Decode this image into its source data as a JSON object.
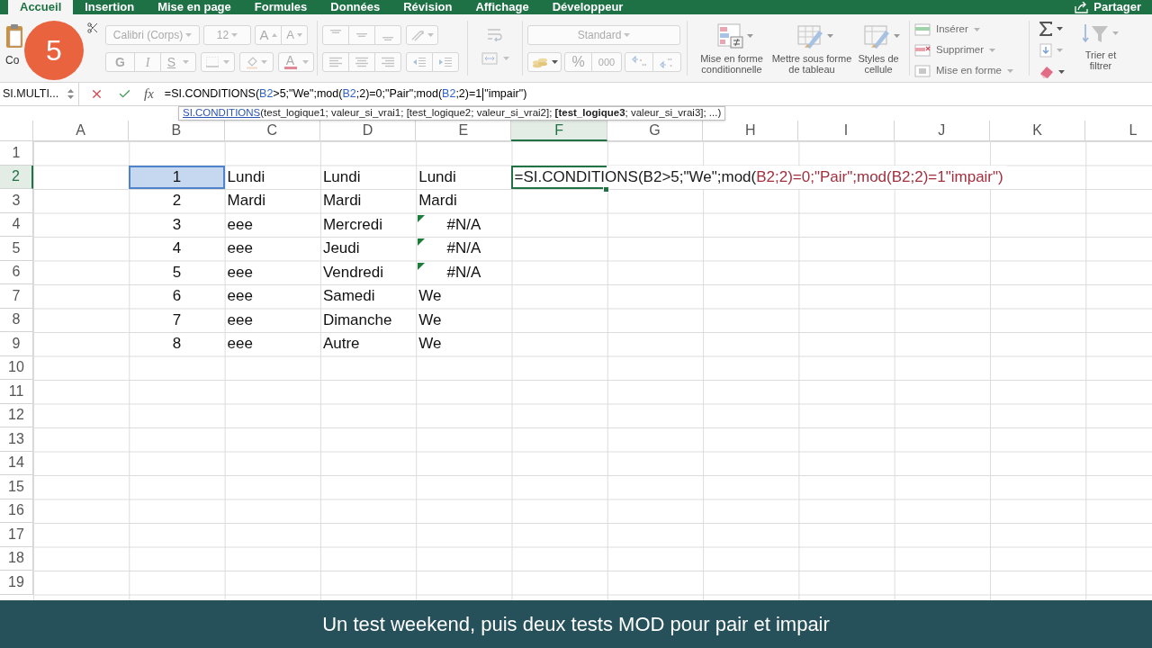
{
  "ribbon_tabs": [
    {
      "label": "Accueil",
      "selected": true
    },
    {
      "label": "Insertion",
      "selected": false
    },
    {
      "label": "Mise en page",
      "selected": false
    },
    {
      "label": "Formules",
      "selected": false
    },
    {
      "label": "Données",
      "selected": false
    },
    {
      "label": "Révision",
      "selected": false
    },
    {
      "label": "Affichage",
      "selected": false
    },
    {
      "label": "Développeur",
      "selected": false
    }
  ],
  "share_button": {
    "label": "Partager"
  },
  "ribbon": {
    "clipboard": {
      "paste_label": "Co"
    },
    "font": {
      "disabled": true,
      "font_name": "Calibri (Corps)",
      "font_size": "12",
      "grow_label": "A",
      "shrink_label": "A",
      "bold_label": "G",
      "italic_label": "I",
      "underline_label": "S",
      "font_color_label": "A"
    },
    "alignment": {
      "disabled": true
    },
    "number": {
      "disabled": true,
      "format": "Standard",
      "percent_label": "%",
      "thousands_label": "000"
    },
    "styles": [
      {
        "kind": "conditional",
        "label": "Mise en forme conditionnelle"
      },
      {
        "kind": "table",
        "label": "Mettre sous forme de tableau"
      },
      {
        "kind": "cell_styles",
        "label": "Styles de cellule"
      }
    ],
    "cells": [
      {
        "kind": "insert",
        "label": "Insérer"
      },
      {
        "kind": "delete",
        "label": "Supprimer"
      },
      {
        "kind": "format",
        "label": "Mise en forme"
      }
    ],
    "editing": {
      "sort_label": "Trier et filtrer"
    }
  },
  "formula_bar": {
    "name_box": "SI.MULTI...",
    "fx_label": "fx",
    "segments": [
      {
        "kind": "text",
        "text": "=SI.CONDITIONS(",
        "color": "#000000"
      },
      {
        "kind": "text",
        "text": "B2",
        "color": "#2f62c8"
      },
      {
        "kind": "text",
        "text": ">5;\"We\";mod(",
        "color": "#000000"
      },
      {
        "kind": "text",
        "text": "B2",
        "color": "#2f62c8"
      },
      {
        "kind": "text",
        "text": ";2)=0;\"Pair\";mod(",
        "color": "#000000"
      },
      {
        "kind": "text",
        "text": "B2",
        "color": "#2f62c8"
      },
      {
        "kind": "text",
        "text": ";2)=1",
        "color": "#000000"
      },
      {
        "kind": "cursor"
      },
      {
        "kind": "text",
        "text": "\"impair\")",
        "color": "#000000"
      }
    ]
  },
  "tooltip": {
    "function_link": "SI.CONDITIONS",
    "arguments": "(test_logique1; valeur_si_vrai1; [test_logique2; valeur_si_vrai2]; **[test_logique3**; valeur_si_vrai3]; ...)"
  },
  "columns": [
    {
      "label": "A",
      "selected": false
    },
    {
      "label": "B",
      "selected": false
    },
    {
      "label": "C",
      "selected": false
    },
    {
      "label": "D",
      "selected": false
    },
    {
      "label": "E",
      "selected": false
    },
    {
      "label": "F",
      "selected": true
    },
    {
      "label": "G",
      "selected": false
    },
    {
      "label": "H",
      "selected": false
    },
    {
      "label": "I",
      "selected": false
    },
    {
      "label": "J",
      "selected": false
    },
    {
      "label": "K",
      "selected": false
    },
    {
      "label": "L",
      "selected": false
    }
  ],
  "rows": [
    {
      "label": "1",
      "selected": false
    },
    {
      "label": "2",
      "selected": true,
      "cells": {
        "b": {
          "kind": "number",
          "value": "1",
          "referenced": true
        },
        "c": {
          "kind": "text",
          "value": "Lundi"
        },
        "d": {
          "kind": "text",
          "value": "Lundi"
        },
        "e": {
          "kind": "text",
          "value": "Lundi"
        },
        "f": {
          "kind": "editing",
          "segments": [
            {
              "text": "=SI.CONDITIONS(B2>5;\"We\";mod(",
              "color": "#1a1a1a"
            },
            {
              "text": "B2;2)=0;\"Pair\";mod(B2;2)=1\"impair\")",
              "color": "#a3303f"
            }
          ]
        }
      }
    },
    {
      "label": "3",
      "selected": false,
      "cells": {
        "b": {
          "kind": "number",
          "value": "2"
        },
        "c": {
          "kind": "text",
          "value": "Mardi"
        },
        "d": {
          "kind": "text",
          "value": "Mardi"
        },
        "e": {
          "kind": "text",
          "value": "Mardi"
        }
      }
    },
    {
      "label": "4",
      "selected": false,
      "cells": {
        "b": {
          "kind": "number",
          "value": "3"
        },
        "c": {
          "kind": "text",
          "value": "eee"
        },
        "d": {
          "kind": "text",
          "value": "Mercredi"
        },
        "e": {
          "kind": "error",
          "value": "#N/A"
        }
      }
    },
    {
      "label": "5",
      "selected": false,
      "cells": {
        "b": {
          "kind": "number",
          "value": "4"
        },
        "c": {
          "kind": "text",
          "value": "eee"
        },
        "d": {
          "kind": "text",
          "value": "Jeudi"
        },
        "e": {
          "kind": "error",
          "value": "#N/A"
        }
      }
    },
    {
      "label": "6",
      "selected": false,
      "cells": {
        "b": {
          "kind": "number",
          "value": "5"
        },
        "c": {
          "kind": "text",
          "value": "eee"
        },
        "d": {
          "kind": "text",
          "value": "Vendredi"
        },
        "e": {
          "kind": "error",
          "value": "#N/A"
        }
      }
    },
    {
      "label": "7",
      "selected": false,
      "cells": {
        "b": {
          "kind": "number",
          "value": "6"
        },
        "c": {
          "kind": "text",
          "value": "eee"
        },
        "d": {
          "kind": "text",
          "value": "Samedi"
        },
        "e": {
          "kind": "text",
          "value": "We"
        }
      }
    },
    {
      "label": "8",
      "selected": false,
      "cells": {
        "b": {
          "kind": "number",
          "value": "7"
        },
        "c": {
          "kind": "text",
          "value": "eee"
        },
        "d": {
          "kind": "text",
          "value": "Dimanche"
        },
        "e": {
          "kind": "text",
          "value": "We"
        }
      }
    },
    {
      "label": "9",
      "selected": false,
      "cells": {
        "b": {
          "kind": "number",
          "value": "8"
        },
        "c": {
          "kind": "text",
          "value": "eee"
        },
        "d": {
          "kind": "text",
          "value": "Autre"
        },
        "e": {
          "kind": "text",
          "value": "We"
        }
      }
    },
    {
      "label": "10",
      "selected": false
    },
    {
      "label": "11",
      "selected": false
    },
    {
      "label": "12",
      "selected": false
    },
    {
      "label": "13",
      "selected": false
    },
    {
      "label": "14",
      "selected": false
    },
    {
      "label": "15",
      "selected": false
    },
    {
      "label": "16",
      "selected": false
    },
    {
      "label": "17",
      "selected": false
    },
    {
      "label": "18",
      "selected": false
    },
    {
      "label": "19",
      "selected": false
    }
  ],
  "step_badge": {
    "label": "5"
  },
  "caption": "Un test weekend, puis deux tests MOD pour pair et impair"
}
